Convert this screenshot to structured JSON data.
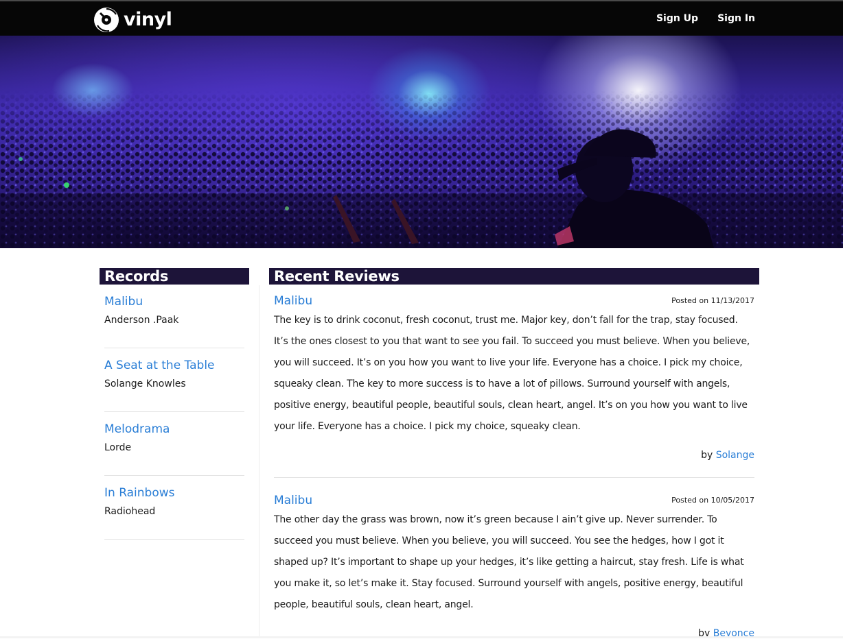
{
  "header": {
    "brand": "vinyl",
    "nav": [
      {
        "label": "Sign Up"
      },
      {
        "label": "Sign In"
      }
    ]
  },
  "sidebar": {
    "title": "Records",
    "records": [
      {
        "title": "Malibu",
        "artist": "Anderson .Paak"
      },
      {
        "title": "A Seat at the Table",
        "artist": "Solange Knowles"
      },
      {
        "title": "Melodrama",
        "artist": "Lorde"
      },
      {
        "title": "In Rainbows",
        "artist": "Radiohead"
      }
    ]
  },
  "main": {
    "title": "Recent Reviews",
    "reviews": [
      {
        "record": "Malibu",
        "posted": "Posted on 11/13/2017",
        "body": "The key is to drink coconut, fresh coconut, trust me. Major key, don’t fall for the trap, stay focused. It’s the ones closest to you that want to see you fail. To succeed you must believe. When you believe, you will succeed. It’s on you how you want to live your life. Everyone has a choice. I pick my choice, squeaky clean. The key to more success is to have a lot of pillows. Surround yourself with angels, positive energy, beautiful people, beautiful souls, clean heart, angel. It’s on you how you want to live your life. Everyone has a choice. I pick my choice, squeaky clean.",
        "by_prefix": "by",
        "author": "Solange"
      },
      {
        "record": "Malibu",
        "posted": "Posted on 10/05/2017",
        "body": "The other day the grass was brown, now it’s green because I ain’t give up. Never surrender. To succeed you must believe. When you believe, you will succeed. You see the hedges, how I got it shaped up? It’s important to shape up your hedges, it’s like getting a haircut, stay fresh. Life is what you make it, so let’s make it. Stay focused. Surround yourself with angels, positive energy, beautiful people, beautiful souls, clean heart, angel.",
        "by_prefix": "by",
        "author": "Beyonce"
      }
    ]
  },
  "colors": {
    "topbar": "#060606",
    "section_header": "#1d1439",
    "link": "#2a7ed6"
  },
  "icons": {
    "logo": "vinyl-record-icon"
  }
}
